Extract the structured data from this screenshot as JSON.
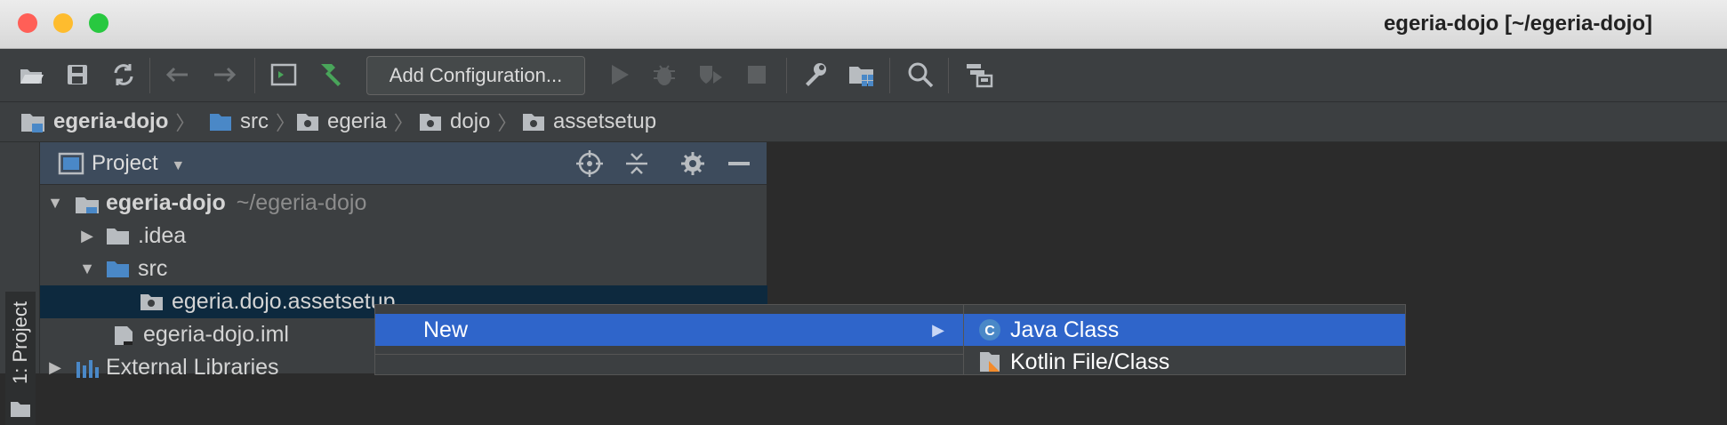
{
  "window": {
    "title": "egeria-dojo [~/egeria-dojo]",
    "traffic_lights": {
      "close": "#ff5f57",
      "minimize": "#febc2e",
      "zoom": "#28c840"
    }
  },
  "toolbar": {
    "icons": [
      "open-folder-icon",
      "save-icon",
      "sync-icon",
      "back-icon",
      "forward-icon",
      "run-window-icon",
      "build-hammer-icon",
      "run-icon",
      "debug-icon",
      "coverage-icon",
      "stop-icon",
      "settings-wrench-icon",
      "project-structure-icon",
      "search-icon",
      "sdk-manager-icon"
    ],
    "config_label": "Add Configuration..."
  },
  "breadcrumb": [
    "egeria-dojo",
    "src",
    "egeria",
    "dojo",
    "assetsetup"
  ],
  "tool_window": {
    "tab_label": "1: Project"
  },
  "project_panel": {
    "title": "Project",
    "tree": [
      {
        "label": "egeria-dojo",
        "hint": "~/egeria-dojo"
      },
      {
        "label": ".idea"
      },
      {
        "label": "src"
      },
      {
        "label": "egeria.dojo.assetsetup"
      },
      {
        "label": "egeria-dojo.iml"
      },
      {
        "label": "External Libraries"
      }
    ]
  },
  "context_menu": {
    "items": [
      {
        "label": "New"
      }
    ],
    "submenu": [
      {
        "label": "Java Class",
        "icon": "java-class-icon"
      },
      {
        "label": "Kotlin File/Class",
        "icon": "kotlin-icon"
      }
    ]
  },
  "colors": {
    "selection": "#2f65ca",
    "panel": "#3c3f41",
    "editor": "#2b2b2b",
    "folder_blue": "#4a88c7"
  }
}
